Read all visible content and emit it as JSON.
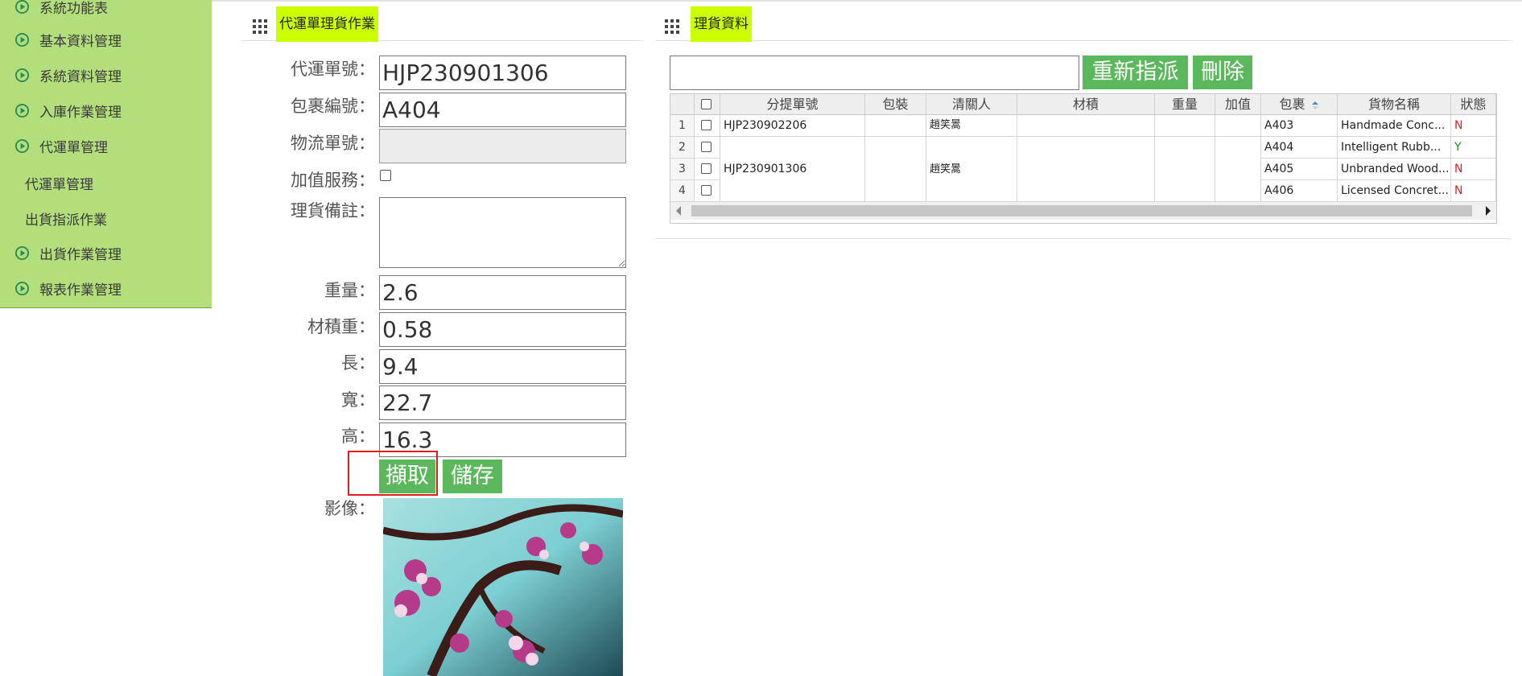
{
  "sidebar": {
    "items": [
      {
        "label": "系統功能表"
      },
      {
        "label": "基本資料管理"
      },
      {
        "label": "系統資料管理"
      },
      {
        "label": "入庫作業管理"
      },
      {
        "label": "代運單管理"
      },
      {
        "label": "出貨作業管理"
      },
      {
        "label": "報表作業管理"
      }
    ],
    "subitems": [
      {
        "label": "代運單管理"
      },
      {
        "label": "出貨指派作業"
      }
    ]
  },
  "left_panel": {
    "title": "代運單理貨作業",
    "labels": {
      "order_no": "代運單號：",
      "package_no": "包裹編號：",
      "logistics_no": "物流單號：",
      "value_added": "加值服務：",
      "remark": "理貨備註：",
      "weight": "重量：",
      "vol_weight": "材積重：",
      "length": "長：",
      "width": "寬：",
      "height": "高：",
      "image": "影像："
    },
    "values": {
      "order_no": "HJP230901306",
      "package_no": "A404",
      "logistics_no": "",
      "remark": "",
      "weight": "2.6",
      "vol_weight": "0.58",
      "length": "9.4",
      "width": "22.7",
      "height": "16.3"
    },
    "buttons": {
      "capture": "擷取",
      "save": "儲存"
    }
  },
  "right_panel": {
    "title": "理貨資料",
    "search_value": "",
    "buttons": {
      "reassign": "重新指派",
      "delete": "刪除"
    },
    "grid": {
      "headers": [
        "分提單號",
        "包裝",
        "清關人",
        "材積",
        "重量",
        "加值",
        "包裹",
        "貨物名稱",
        "狀態"
      ],
      "rows": [
        {
          "n": "1",
          "pkg": "A403",
          "name": "Handmade Conc...",
          "status": "N"
        },
        {
          "n": "2",
          "pkg": "A404",
          "name": "Intelligent Rubb...",
          "status": "Y"
        },
        {
          "n": "3",
          "pkg": "A405",
          "name": "Unbranded Wood...",
          "status": "N"
        },
        {
          "n": "4",
          "pkg": "A406",
          "name": "Licensed Concret...",
          "status": "N"
        }
      ],
      "groups": [
        {
          "bill": "HJP230902206",
          "person": "趙笑暠"
        },
        {
          "bill": "HJP230901306",
          "person": "趙笑暠"
        }
      ]
    }
  },
  "colors": {
    "sidebar_bg": "#b3de7c",
    "title_highlight": "#ccff00",
    "button_green": "#5cb85c",
    "status_y": "#1a8f1a",
    "status_n": "#e02020",
    "callout_red": "#e02020"
  }
}
